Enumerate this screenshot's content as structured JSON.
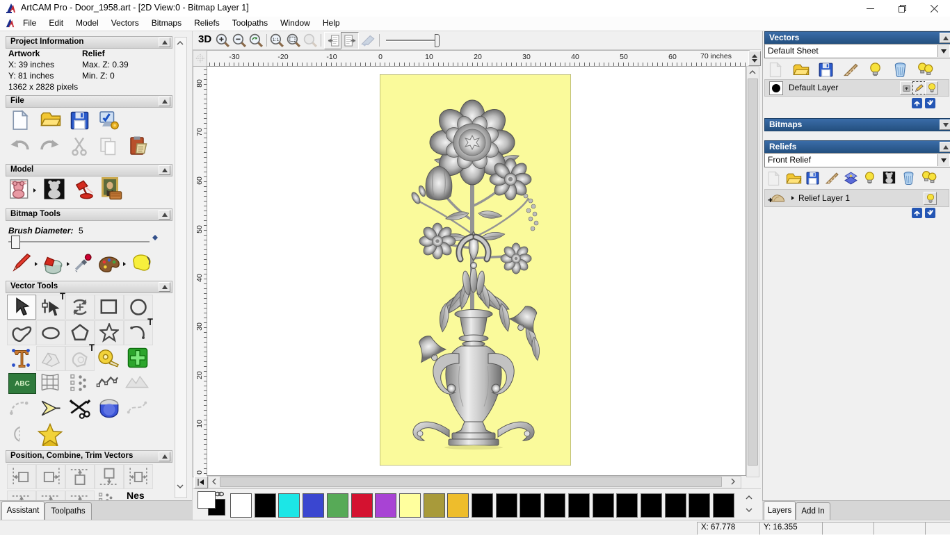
{
  "window": {
    "title": "ArtCAM Pro - Door_1958.art - [2D View:0 - Bitmap Layer 1]"
  },
  "menu": {
    "items": [
      "File",
      "Edit",
      "Model",
      "Vectors",
      "Bitmaps",
      "Reliefs",
      "Toolpaths",
      "Window",
      "Help"
    ]
  },
  "assistant": {
    "tabs": {
      "assistant": "Assistant",
      "toolpaths": "Toolpaths"
    },
    "project_information": {
      "title": "Project Information",
      "artwork_label": "Artwork",
      "relief_label": "Relief",
      "artwork_x": "X: 39 inches",
      "artwork_y": "Y: 81 inches",
      "artwork_pixels": "1362 x 2828 pixels",
      "relief_max_z": "Max. Z: 0.39",
      "relief_min_z": "Min. Z: 0"
    },
    "file": {
      "title": "File"
    },
    "model": {
      "title": "Model"
    },
    "bitmap_tools": {
      "title": "Bitmap Tools",
      "brush_diameter_label": "Brush Diameter:",
      "brush_diameter_value": "5"
    },
    "vector_tools": {
      "title": "Vector Tools",
      "abc_icon_text": "ABC"
    },
    "position_combine_trim": {
      "title": "Position, Combine, Trim Vectors",
      "nesting_icon_text": "Nes"
    }
  },
  "view": {
    "toolbar": {
      "btn_3d": "3D"
    },
    "ruler": {
      "h_labels": [
        -30,
        -20,
        -10,
        0,
        10,
        20,
        30,
        40,
        50,
        60
      ],
      "unit_label": "70 inches",
      "v_labels": [
        80,
        70,
        60,
        50,
        40,
        30,
        20,
        10,
        0
      ]
    }
  },
  "vectors_panel": {
    "title": "Vectors",
    "sheet": "Default Sheet",
    "layer": "Default Layer"
  },
  "bitmaps_panel": {
    "title": "Bitmaps"
  },
  "reliefs_panel": {
    "title": "Reliefs",
    "relief": "Front Relief",
    "layer": "Relief Layer 1"
  },
  "right_tabs": {
    "layers": "Layers",
    "add_in": "Add In"
  },
  "status": {
    "x": "X: 67.778",
    "y": "Y: 16.355"
  },
  "palette": {
    "foreground": "#ffffff",
    "background": "#000000",
    "swatches": [
      "#ffffff",
      "#000000",
      "#1ce6e6",
      "#3a46d0",
      "#57aa57",
      "#d41230",
      "#a843d4",
      "#ffff9e",
      "#a89a3a",
      "#eebd2c",
      "#000000",
      "#000000",
      "#000000",
      "#000000",
      "#000000",
      "#000000",
      "#000000",
      "#000000",
      "#000000",
      "#000000",
      "#000000"
    ]
  },
  "artwork": {
    "background": "#fafa9b"
  }
}
